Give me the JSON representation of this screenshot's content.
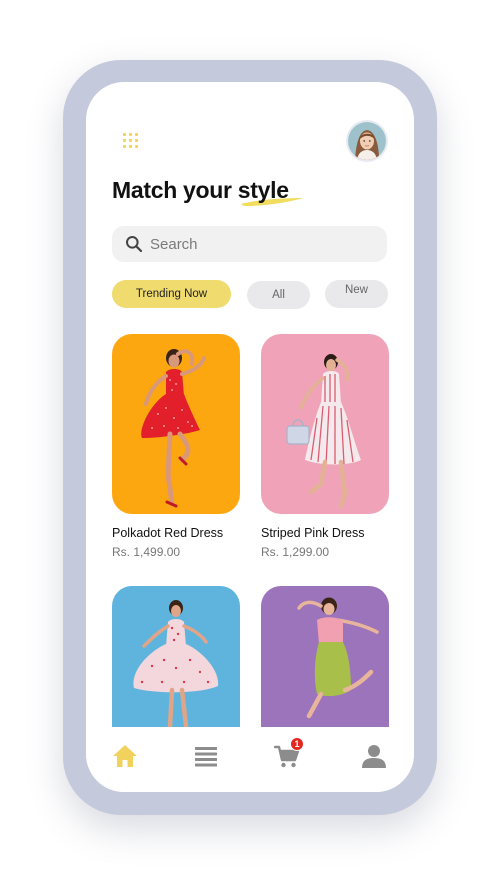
{
  "header": {
    "title_prefix": "Match your ",
    "title_highlight": "style",
    "menu_icon": "grid-menu-icon",
    "avatar_icon": "user-avatar"
  },
  "search": {
    "placeholder": "Search",
    "value": ""
  },
  "filters": [
    {
      "label": "Trending Now",
      "active": true
    },
    {
      "label": "All",
      "active": false
    },
    {
      "label": "New",
      "active": false
    }
  ],
  "products": [
    {
      "name": "Polkadot Red Dress",
      "price": "Rs.  1,499.00",
      "bg_color": "#fca70f"
    },
    {
      "name": "Striped Pink Dress",
      "price": "Rs.  1,299.00",
      "bg_color": "#f0a3b8"
    },
    {
      "name": "",
      "price": "",
      "bg_color": "#5fb4de"
    },
    {
      "name": "",
      "price": "",
      "bg_color": "#9b74bb"
    }
  ],
  "bottom_nav": {
    "items": [
      "home-icon",
      "list-icon",
      "cart-icon",
      "profile-icon"
    ],
    "cart_badge": "1"
  },
  "colors": {
    "accent": "#f0d25c",
    "frame": "#c5c9dc",
    "badge": "#e5281f"
  }
}
